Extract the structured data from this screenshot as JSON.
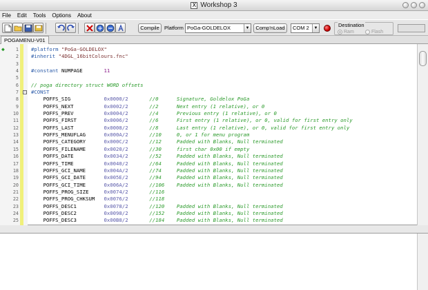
{
  "window": {
    "title": "Workshop 3"
  },
  "menu": [
    "File",
    "Edit",
    "Tools",
    "Options",
    "About"
  ],
  "toolbar": {
    "compile_label": "Compile",
    "platform_label": "Platform",
    "platform_value": "PoGa-GOLDELOX",
    "compload_label": "Comp'nLoad",
    "com_value": "COM 2",
    "destination_label": "Destination",
    "ram_label": "Ram",
    "flash_label": "Flash"
  },
  "tab": {
    "label": "POGAMENU-V01"
  },
  "lines": [
    {
      "n": "1",
      "html": "<span class=\"dir\">#platform</span> <span class=\"str\">\"PoGa-GOLDELOX\"</span>"
    },
    {
      "n": "2",
      "html": "<span class=\"dir\">#inherit</span> <span class=\"str\">\"4DGL_16bitColours.fnc\"</span>"
    },
    {
      "n": "3",
      "html": ""
    },
    {
      "n": "4",
      "html": "<span class=\"dir\">#constant</span> NUMPAGE       <span class=\"num\">11</span>"
    },
    {
      "n": "5",
      "html": ""
    },
    {
      "n": "6",
      "html": "<span class=\"cmt\">// poga directory struct WORD offsets</span>"
    },
    {
      "n": "7",
      "html": "<span class=\"dir\">#CONST</span>"
    },
    {
      "n": "8",
      "html": "    POFFS_SIG           <span class=\"id\">0x0000/2</span>       <span class=\"cmt\">//0      Signature, Goldelox PoGa</span>"
    },
    {
      "n": "9",
      "html": "    POFFS_NEXT          <span class=\"id\">0x0002/2</span>       <span class=\"cmt\">//2      Next entry (1 relative), or 0</span>"
    },
    {
      "n": "10",
      "html": "    POFFS_PREV          <span class=\"id\">0x0004/2</span>       <span class=\"cmt\">//4      Previous entry (1 relative), or 0</span>"
    },
    {
      "n": "11",
      "html": "    POFFS_FIRST         <span class=\"id\">0x0006/2</span>       <span class=\"cmt\">//6      First entry (1 relative), or 0, valid for first entry only</span>"
    },
    {
      "n": "12",
      "html": "    POFFS_LAST          <span class=\"id\">0x0008/2</span>       <span class=\"cmt\">//8      Last entry (1 relative), or 0, valid for first entry only</span>"
    },
    {
      "n": "13",
      "html": "    POFFS_MENUFLAG      <span class=\"id\">0x000A/2</span>       <span class=\"cmt\">//10     0, or 1 for menu program</span>"
    },
    {
      "n": "14",
      "html": "    POFFS_CATEGORY      <span class=\"id\">0x000C/2</span>       <span class=\"cmt\">//12     Padded with Blanks, Null terminated</span>"
    },
    {
      "n": "15",
      "html": "    POFFS_FILENAME      <span class=\"id\">0x0020/2</span>       <span class=\"cmt\">//30     first char 0x00 if empty</span>"
    },
    {
      "n": "16",
      "html": "    POFFS_DATE          <span class=\"id\">0x0034/2</span>       <span class=\"cmt\">//52     Padded with Blanks, Null terminated</span>"
    },
    {
      "n": "17",
      "html": "    POFFS_TIME          <span class=\"id\">0x0040/2</span>       <span class=\"cmt\">//64     Padded with Blanks, Null terminated</span>"
    },
    {
      "n": "18",
      "html": "    POFFS_GCI_NAME      <span class=\"id\">0x004A/2</span>       <span class=\"cmt\">//74     Padded with Blanks, Null terminated</span>"
    },
    {
      "n": "19",
      "html": "    POFFS_GCI_DATE      <span class=\"id\">0x005E/2</span>       <span class=\"cmt\">//94     Padded with Blanks, Null terminated</span>"
    },
    {
      "n": "20",
      "html": "    POFFS_GCI_TIME      <span class=\"id\">0x006A/2</span>       <span class=\"cmt\">//106    Padded with Blanks, Null terminated</span>"
    },
    {
      "n": "21",
      "html": "    POFFS_PROG_SIZE     <span class=\"id\">0x0074/2</span>       <span class=\"cmt\">//116</span>"
    },
    {
      "n": "22",
      "html": "    POFFS_PROG_CHKSUM   <span class=\"id\">0x0076/2</span>       <span class=\"cmt\">//118</span>"
    },
    {
      "n": "23",
      "html": "    POFFS_DESC1         <span class=\"id\">0x0078/2</span>       <span class=\"cmt\">//120    Padded with Blanks, Null terminated</span>"
    },
    {
      "n": "24",
      "html": "    POFFS_DESC2         <span class=\"id\">0x0098/2</span>       <span class=\"cmt\">//152    Padded with Blanks, Null terminated</span>"
    },
    {
      "n": "25",
      "html": "    POFFS_DESC3         <span class=\"id\">0x00B8/2</span>       <span class=\"cmt\">//184    Padded with Blanks, Null terminated</span>"
    }
  ]
}
